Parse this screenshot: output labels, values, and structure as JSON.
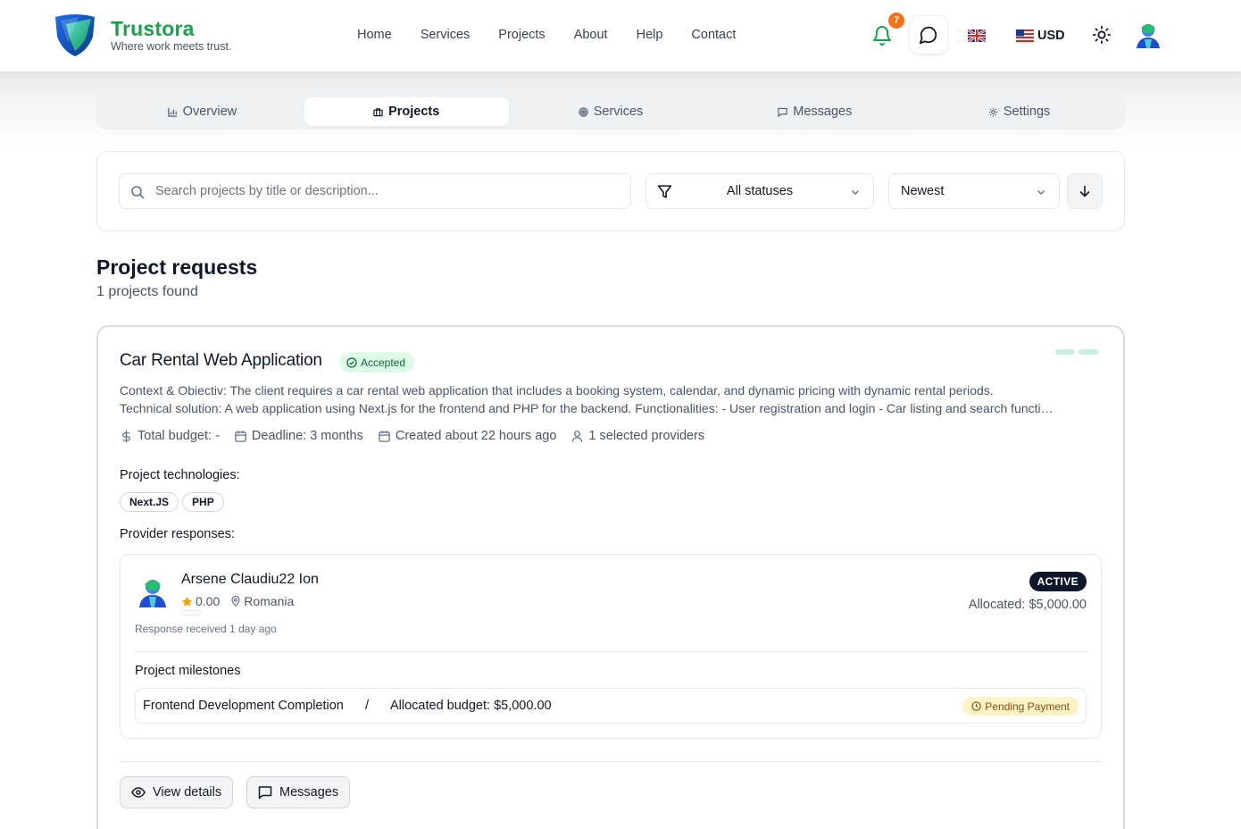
{
  "brand": {
    "name": "Trustora",
    "tagline": "Where work meets trust."
  },
  "nav": [
    "Home",
    "Services",
    "Projects",
    "About",
    "Help",
    "Contact"
  ],
  "header": {
    "notification_count": "7",
    "currency": "USD",
    "language_flag": "uk-flag-icon",
    "currency_flag": "us-flag-icon"
  },
  "tabs": [
    {
      "label": "Overview",
      "icon": "chart-icon"
    },
    {
      "label": "Projects",
      "icon": "briefcase-icon",
      "active": true
    },
    {
      "label": "Services",
      "icon": "target-icon"
    },
    {
      "label": "Messages",
      "icon": "message-icon"
    },
    {
      "label": "Settings",
      "icon": "gear-icon"
    }
  ],
  "filters": {
    "search_placeholder": "Search projects by title or description...",
    "status": "All statuses",
    "sort": "Newest"
  },
  "section": {
    "title": "Project requests",
    "count": "1 projects found"
  },
  "project": {
    "title": "Car Rental Web Application",
    "status": "Accepted",
    "description_line1": "Context & Obiectiv: The client requires a car rental web application that includes a booking system, calendar, and dynamic pricing with dynamic rental periods.",
    "description_line2": "Technical solution: A web application using Next.js for the frontend and PHP for the backend. Functionalities: - User registration and login - Car listing and search functionality - Booking system",
    "budget": "Total budget: -",
    "deadline": "Deadline: 3 months",
    "created": "Created about 22 hours ago",
    "providers": "1 selected providers",
    "technologies_label": "Project technologies:",
    "technologies": [
      "Next.JS",
      "PHP"
    ],
    "responses_label": "Provider responses:",
    "response": {
      "provider_name": "Arsene Claudiu22 Ion",
      "rating": "0.00",
      "location": "Romania",
      "received": "Response received 1 day ago",
      "status": "ACTIVE",
      "allocated": "Allocated: $5,000.00",
      "milestones_label": "Project milestones",
      "milestone": {
        "title": "Frontend Development Completion",
        "separator": "/",
        "budget": "Allocated budget: $5,000.00",
        "status": "Pending Payment"
      }
    },
    "actions": {
      "view_details": "View details",
      "messages": "Messages"
    }
  },
  "colors": {
    "brand_green": "#16a34a",
    "accepted_bg": "#dcfce7",
    "pending_bg": "#fef3c7",
    "notification": "#f97316"
  }
}
